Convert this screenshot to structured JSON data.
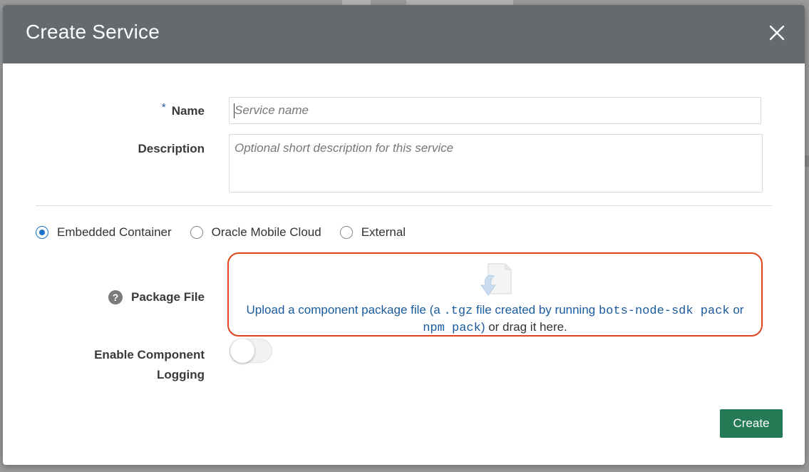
{
  "dialog": {
    "title": "Create Service",
    "close_icon": "close-icon"
  },
  "form": {
    "name": {
      "required_marker": "*",
      "label": "Name",
      "value": "",
      "placeholder": "Service name"
    },
    "description": {
      "label": "Description",
      "value": "",
      "placeholder": "Optional short description for this service"
    },
    "service_type": {
      "options": [
        {
          "label": "Embedded Container",
          "checked": true
        },
        {
          "label": "Oracle Mobile Cloud",
          "checked": false
        },
        {
          "label": "External",
          "checked": false
        }
      ]
    },
    "package_file": {
      "help_icon": "help-icon",
      "help_glyph": "?",
      "label": "Package File",
      "upload_icon": "file-upload-icon",
      "text_part1": "Upload a component package file (a ",
      "code1": ".tgz",
      "text_part2": " file created by running ",
      "code2": "bots-node-sdk pack",
      "text_part3": " or",
      "code3": "npm pack",
      "text_part4": ")",
      "text_part5": " or drag it here."
    },
    "logging": {
      "label_line1": "Enable Component",
      "label_line2": "Logging",
      "enabled": false
    }
  },
  "actions": {
    "create_label": "Create"
  },
  "colors": {
    "header_bg": "#646a6e",
    "accent_blue": "#1a73c8",
    "link_blue": "#1a5a9c",
    "dropzone_border": "#e0441c",
    "primary_button": "#237a55"
  }
}
